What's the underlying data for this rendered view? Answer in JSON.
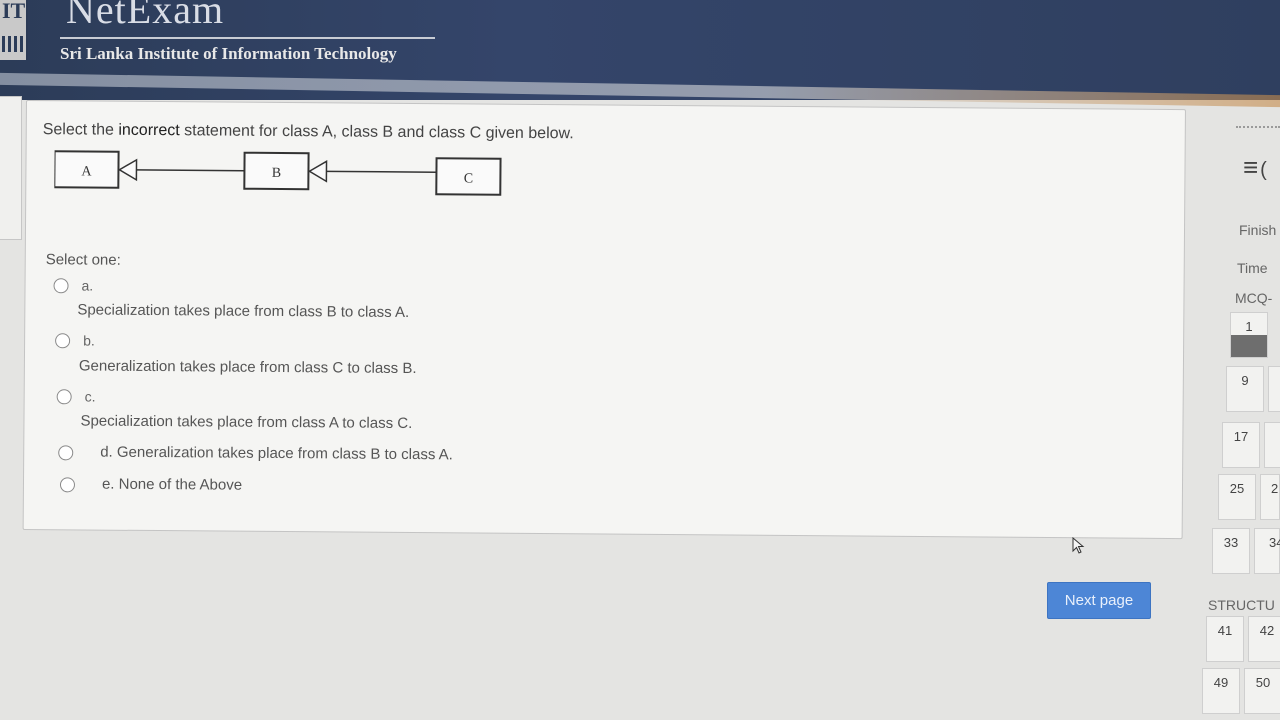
{
  "header": {
    "brand": "NetExam",
    "institute": "Sri Lanka Institute of Information Technology",
    "logo_letters": "IT"
  },
  "question": {
    "text_before": "Select the ",
    "text_emphasis": "incorrect",
    "text_after": " statement for class A, class B and class C given below.",
    "diagram": {
      "classes": [
        "A",
        "B",
        "C"
      ]
    },
    "select_one_label": "Select one:",
    "options": [
      {
        "letter": "a.",
        "text": "Specialization takes place from class B to class A."
      },
      {
        "letter": "b.",
        "text": "Generalization takes place from class C to class B."
      },
      {
        "letter": "c.",
        "text": "Specialization takes place from class A to class C."
      },
      {
        "letter": "",
        "text": "d. Generalization takes place from class B to class A."
      },
      {
        "letter": "",
        "text": "e. None of the Above"
      }
    ]
  },
  "buttons": {
    "next_page": "Next page"
  },
  "nav": {
    "menu_icon": "hamburger-icon",
    "finish_label": "Finish",
    "time_label": "Time",
    "mcq_label": "MCQ-",
    "structured_label": "STRUCTU",
    "question_numbers": [
      "1",
      "9",
      "17",
      "25",
      "2",
      "33",
      "34",
      "41",
      "42",
      "49",
      "50"
    ]
  }
}
